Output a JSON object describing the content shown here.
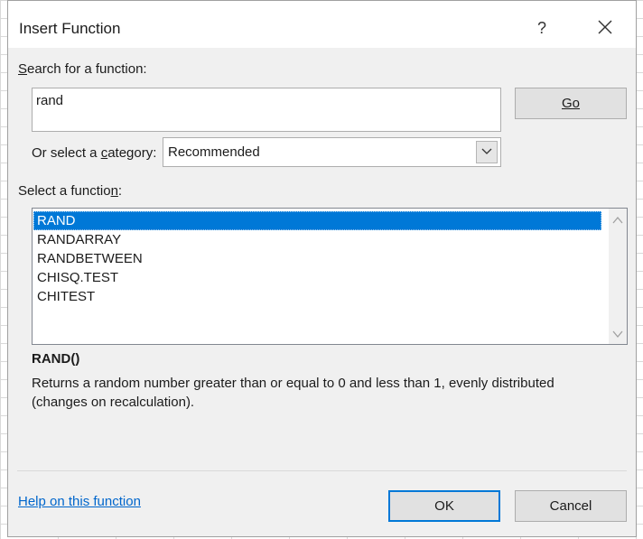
{
  "dialog": {
    "title": "Insert Function",
    "help_label": "?",
    "close_icon": "close-icon"
  },
  "search": {
    "label": "Search for a function:",
    "value": "rand",
    "go_label": "Go"
  },
  "category": {
    "label": "Or select a category:",
    "selected": "Recommended",
    "dropdown_icon": "chevron-down-icon"
  },
  "functions": {
    "label": "Select a function:",
    "items": [
      "RAND",
      "RANDARRAY",
      "RANDBETWEEN",
      "CHISQ.TEST",
      "CHITEST"
    ],
    "selected": "RAND"
  },
  "details": {
    "signature": "RAND()",
    "description": "Returns a random number greater than or equal to 0 and less than 1, evenly distributed (changes on recalculation)."
  },
  "footer": {
    "help_link": "Help on this function",
    "ok_label": "OK",
    "cancel_label": "Cancel"
  },
  "colors": {
    "selection": "#0078d7",
    "link": "#0066cc",
    "dialog_bg": "#f0f0f0"
  }
}
